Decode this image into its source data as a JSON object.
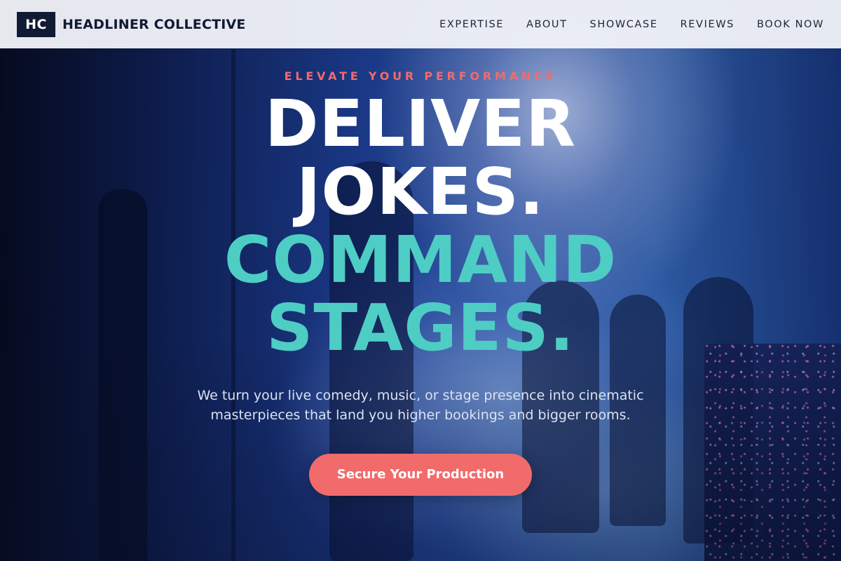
{
  "header": {
    "logo_initials": "HC",
    "brand_name": "HEADLINER COLLECTIVE",
    "nav": [
      {
        "label": "EXPERTISE"
      },
      {
        "label": "ABOUT"
      },
      {
        "label": "SHOWCASE"
      },
      {
        "label": "REVIEWS"
      },
      {
        "label": "BOOK NOW"
      }
    ]
  },
  "hero": {
    "eyebrow": "ELEVATE YOUR PERFORMANCE",
    "headline_lines": [
      "DELIVER",
      "JOKES.",
      "COMMAND",
      "STAGES."
    ],
    "subtext": "We turn your live comedy, music, or stage presence into cinematic masterpieces that land you higher bookings and bigger rooms.",
    "cta_label": "Secure Your Production"
  },
  "colors": {
    "accent_coral": "#f26b6b",
    "accent_teal": "#4ecdc4",
    "brand_navy": "#111a35",
    "header_bg": "#eff1f7"
  }
}
